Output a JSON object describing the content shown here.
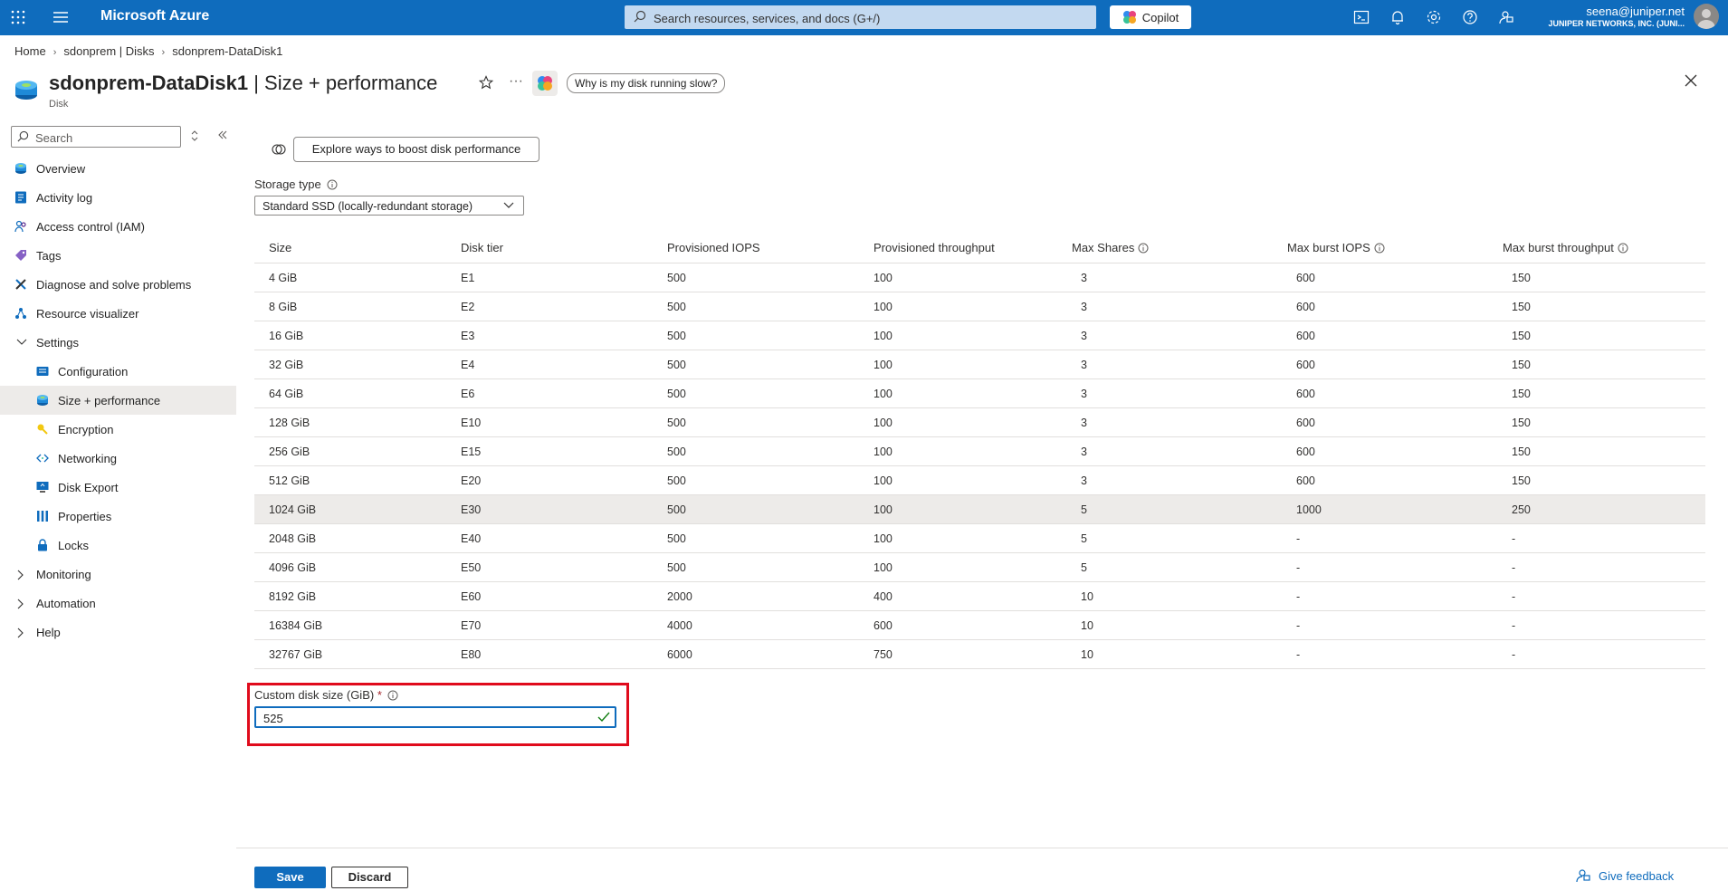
{
  "topbar": {
    "brand": "Microsoft Azure",
    "search_placeholder": "Search resources, services, and docs (G+/)",
    "copilot_label": "Copilot",
    "account_email": "seena@juniper.net",
    "account_org": "JUNIPER NETWORKS, INC. (JUNI..."
  },
  "breadcrumb": [
    "Home",
    "sdonprem | Disks",
    "sdonprem-DataDisk1"
  ],
  "header": {
    "title_resource": "sdonprem-DataDisk1",
    "title_section": " | Size + performance",
    "subtitle": "Disk",
    "why_button": "Why is my disk running slow?"
  },
  "sidebar": {
    "search_placeholder": "Search",
    "items": [
      {
        "label": "Overview"
      },
      {
        "label": "Activity log"
      },
      {
        "label": "Access control (IAM)"
      },
      {
        "label": "Tags"
      },
      {
        "label": "Diagnose and solve problems"
      },
      {
        "label": "Resource visualizer"
      },
      {
        "label": "Settings"
      },
      {
        "label": "Configuration"
      },
      {
        "label": "Size + performance"
      },
      {
        "label": "Encryption"
      },
      {
        "label": "Networking"
      },
      {
        "label": "Disk Export"
      },
      {
        "label": "Properties"
      },
      {
        "label": "Locks"
      },
      {
        "label": "Monitoring"
      },
      {
        "label": "Automation"
      },
      {
        "label": "Help"
      }
    ]
  },
  "main": {
    "boost_button": "Explore ways to boost disk performance",
    "storage_type_label": "Storage type",
    "storage_type_value": "Standard SSD (locally-redundant storage)",
    "table": {
      "headers": [
        "Size",
        "Disk tier",
        "Provisioned IOPS",
        "Provisioned throughput",
        "Max Shares",
        "Max burst IOPS",
        "Max burst throughput"
      ],
      "rows": [
        [
          "4 GiB",
          "E1",
          "500",
          "100",
          "3",
          "600",
          "150"
        ],
        [
          "8 GiB",
          "E2",
          "500",
          "100",
          "3",
          "600",
          "150"
        ],
        [
          "16 GiB",
          "E3",
          "500",
          "100",
          "3",
          "600",
          "150"
        ],
        [
          "32 GiB",
          "E4",
          "500",
          "100",
          "3",
          "600",
          "150"
        ],
        [
          "64 GiB",
          "E6",
          "500",
          "100",
          "3",
          "600",
          "150"
        ],
        [
          "128 GiB",
          "E10",
          "500",
          "100",
          "3",
          "600",
          "150"
        ],
        [
          "256 GiB",
          "E15",
          "500",
          "100",
          "3",
          "600",
          "150"
        ],
        [
          "512 GiB",
          "E20",
          "500",
          "100",
          "3",
          "600",
          "150"
        ],
        [
          "1024 GiB",
          "E30",
          "500",
          "100",
          "5",
          "1000",
          "250"
        ],
        [
          "2048 GiB",
          "E40",
          "500",
          "100",
          "5",
          "-",
          "-"
        ],
        [
          "4096 GiB",
          "E50",
          "500",
          "100",
          "5",
          "-",
          "-"
        ],
        [
          "8192 GiB",
          "E60",
          "2000",
          "400",
          "10",
          "-",
          "-"
        ],
        [
          "16384 GiB",
          "E70",
          "4000",
          "600",
          "10",
          "-",
          "-"
        ],
        [
          "32767 GiB",
          "E80",
          "6000",
          "750",
          "10",
          "-",
          "-"
        ]
      ]
    },
    "custom_size_label": "Custom disk size (GiB)",
    "custom_size_required": "*",
    "custom_size_value": "525"
  },
  "footer": {
    "save_label": "Save",
    "discard_label": "Discard",
    "feedback_label": "Give feedback"
  },
  "colors": {
    "accent": "#0f6cbd",
    "highlight": "#e00b1c",
    "selected_row": "#edebe9"
  }
}
